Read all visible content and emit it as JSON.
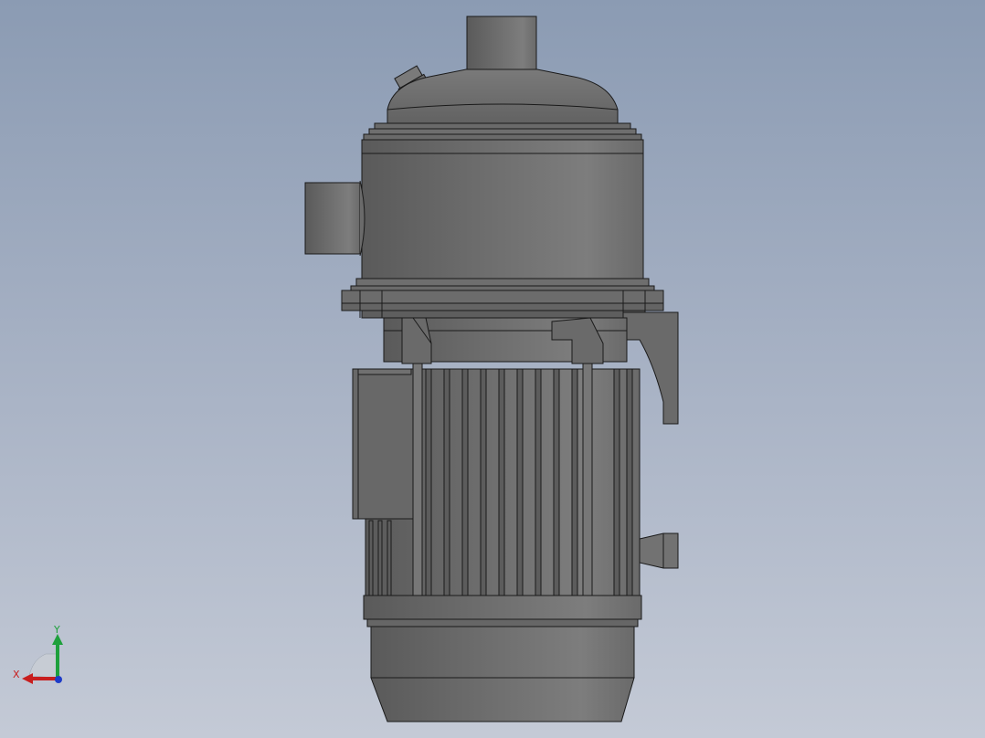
{
  "viewport": {
    "background_top": "#8b9bb3",
    "background_bottom": "#c4cad6"
  },
  "model": {
    "icon": "pump-motor-3d-model",
    "body_color": "#6c6c6c",
    "edge_color": "#1a1a1a"
  },
  "triad": {
    "x_label": "X",
    "y_label": "Y",
    "x_color": "#c81e1e",
    "y_color": "#1ea03c",
    "z_color": "#1e3cc8"
  }
}
